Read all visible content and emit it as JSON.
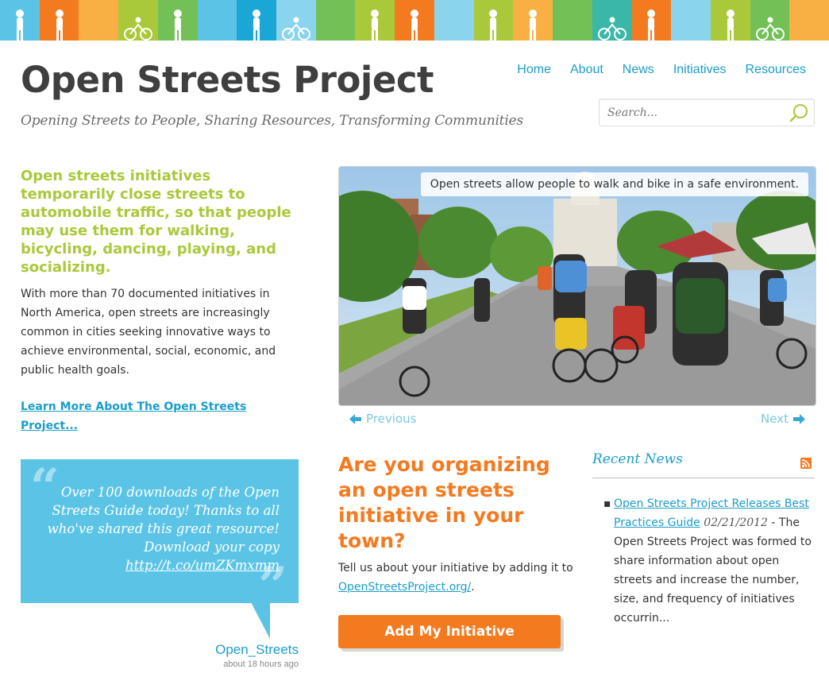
{
  "colors": {
    "accent_blue": "#1a9dc9",
    "accent_green": "#a9c93a",
    "accent_orange": "#f47a20",
    "tweet_blue": "#5bc4e6"
  },
  "banner": {
    "strip_colors": [
      "#5bc4e6",
      "#f47a20",
      "#f8b045",
      "#a9c93a",
      "#73c057",
      "#5bc4e6",
      "#1aa7d6",
      "#8ad4ee",
      "#73c057",
      "#a9c93a",
      "#f47a20",
      "#8ad4ee",
      "#a9c93a",
      "#f8b045",
      "#73c057",
      "#3ab7a7",
      "#f47a20",
      "#8ad4ee",
      "#a9c93a",
      "#73c057",
      "#f8b045"
    ]
  },
  "header": {
    "site_title": "Open Streets Project",
    "tagline": "Opening Streets to People, Sharing Resources, Transforming Communities"
  },
  "nav": {
    "items": [
      "Home",
      "About",
      "News",
      "Initiatives",
      "Resources"
    ]
  },
  "search": {
    "placeholder": "Search..."
  },
  "intro": {
    "lead": "Open streets initiatives temporarily close streets to automobile traffic, so that people may use them for walking, bicycling, dancing, playing, and socializing.",
    "body": "With more than 70 documented initiatives in North America, open streets are increasingly common in cities seeking innovative ways to achieve environmental, social, economic, and public health goals.",
    "learn_more": "Learn More About The Open Streets Project..."
  },
  "tweet": {
    "text": "Over 100 downloads of the Open Streets Guide today! Thanks to all who've shared this great resource! Download your copy",
    "link": "http://t.co/umZKmxmm",
    "author": "Open_Streets",
    "time": "about 18 hours ago"
  },
  "slideshow": {
    "caption": "Open streets allow people to walk and bike in a safe environment.",
    "prev_label": "Previous",
    "next_label": "Next"
  },
  "organize": {
    "title": "Are you organizing an open streets initiative in your town?",
    "body": "Tell us about your initiative by adding it to",
    "link": "OpenStreetsProject.org/",
    "body_end": ".",
    "button": "Add My Initiative"
  },
  "news": {
    "title": "Recent News",
    "item_link": "Open Streets Project Releases Best Practices Guide",
    "item_date": "02/21/2012",
    "item_sep": " - ",
    "item_text": "The Open Streets Project was formed to share information about open streets and increase the number, size, and frequency of initiatives occurrin..."
  }
}
